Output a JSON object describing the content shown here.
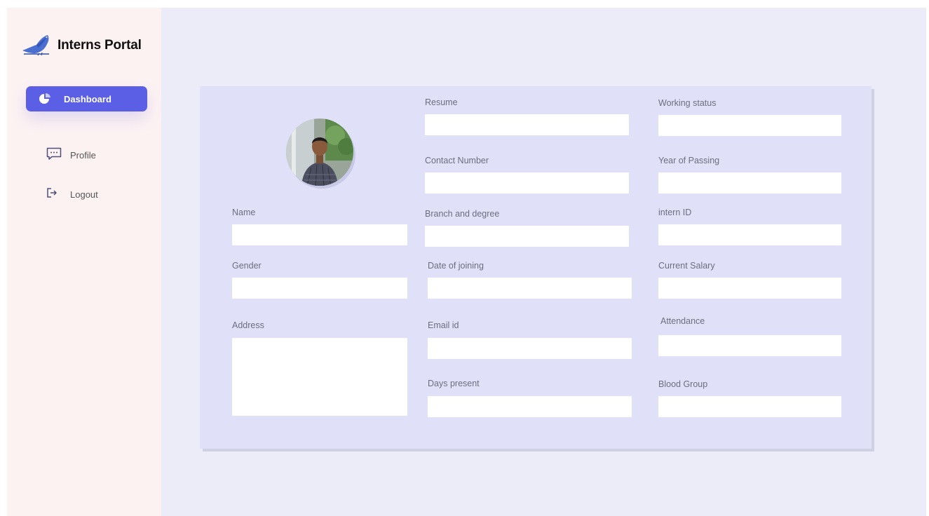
{
  "app": {
    "title": "Interns Portal"
  },
  "sidebar": {
    "items": [
      {
        "label": "Dashboard",
        "icon": "pie-chart-icon",
        "active": true
      },
      {
        "label": "Profile",
        "icon": "message-icon"
      },
      {
        "label": "Logout",
        "icon": "logout-icon"
      }
    ]
  },
  "colors": {
    "accent": "#5b5fe6",
    "sidebar_bg": "#fdf2f2",
    "main_bg": "#ecebf8",
    "card_bg": "#e0e0f8"
  },
  "form": {
    "name_label": "Name",
    "gender_label": "Gender",
    "address_label": "Address",
    "resume_label": "Resume",
    "contact_label": "Contact Number",
    "branch_label": "Branch and  degree",
    "doj_label": "Date of joining",
    "email_label": "Email id",
    "days_label": "Days present",
    "working_label": "Working status",
    "yop_label": "Year of Passing",
    "intern_id_label": "intern ID",
    "salary_label": "Current Salary",
    "attendance_label": "Attendance",
    "blood_label": "Blood Group"
  }
}
